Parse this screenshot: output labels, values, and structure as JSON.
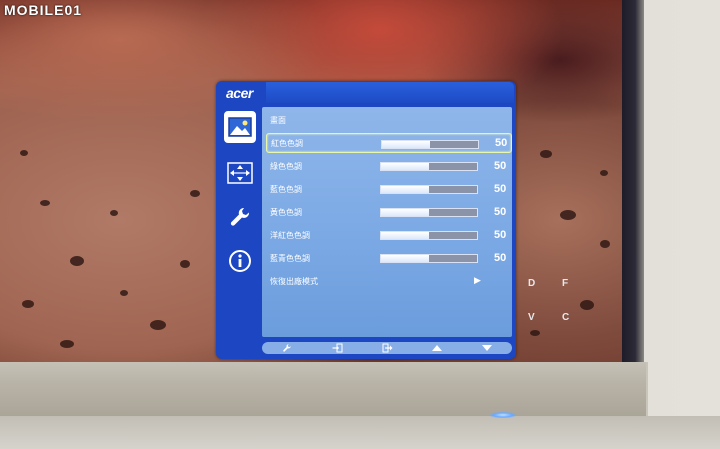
{
  "watermark": "MOBILE01",
  "osd": {
    "brand": "acer",
    "section_title": "畫面",
    "tabs": [
      {
        "name": "picture",
        "icon": "picture-icon",
        "active": true
      },
      {
        "name": "display",
        "icon": "display-position-icon",
        "active": false
      },
      {
        "name": "settings",
        "icon": "wrench-icon",
        "active": false
      },
      {
        "name": "info",
        "icon": "info-icon",
        "active": false
      }
    ],
    "rows": [
      {
        "label": "紅色色調",
        "value": "50",
        "level": 0.5,
        "selected": true
      },
      {
        "label": "綠色色調",
        "value": "50",
        "level": 0.5,
        "selected": false
      },
      {
        "label": "藍色色調",
        "value": "50",
        "level": 0.5,
        "selected": false
      },
      {
        "label": "黃色色調",
        "value": "50",
        "level": 0.5,
        "selected": false
      },
      {
        "label": "洋紅色色調",
        "value": "50",
        "level": 0.5,
        "selected": false
      },
      {
        "label": "藍青色色調",
        "value": "50",
        "level": 0.5,
        "selected": false
      }
    ],
    "reset_label": "恢復出廠模式",
    "bottom_buttons": [
      "wrench-icon",
      "enter-icon",
      "exit-icon",
      "up-arrow-icon",
      "down-arrow-icon"
    ]
  },
  "hotkey_letters": [
    "D",
    "F",
    "V",
    "C"
  ],
  "colors": {
    "osd_frame": "#1c46c2",
    "osd_panel": "#7aa8e4",
    "selection_border": "#e9f7a8"
  }
}
